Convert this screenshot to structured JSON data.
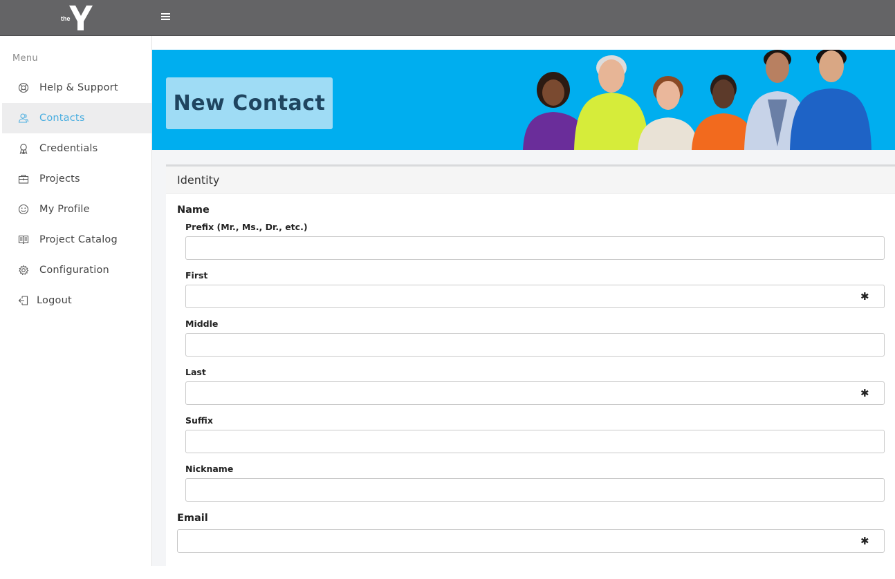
{
  "topbar": {
    "logo_text": "the"
  },
  "sidebar": {
    "menu_title": "Menu",
    "items": [
      {
        "label": "Help & Support",
        "icon": "lifebuoy-icon",
        "active": false
      },
      {
        "label": "Contacts",
        "icon": "users-icon",
        "active": true
      },
      {
        "label": "Credentials",
        "icon": "badge-icon",
        "active": false
      },
      {
        "label": "Projects",
        "icon": "briefcase-icon",
        "active": false
      },
      {
        "label": "My Profile",
        "icon": "smiley-icon",
        "active": false
      },
      {
        "label": "Project Catalog",
        "icon": "book-icon",
        "active": false
      },
      {
        "label": "Configuration",
        "icon": "gear-icon",
        "active": false
      },
      {
        "label": "Logout",
        "icon": "logout-icon",
        "active": false
      }
    ]
  },
  "hero": {
    "title": "New Contact"
  },
  "panel": {
    "title": "Identity",
    "name_section": "Name",
    "fields": {
      "prefix": {
        "label": "Prefix (Mr., Ms., Dr., etc.)",
        "value": ""
      },
      "first": {
        "label": "First",
        "value": "",
        "required_mark": "✱"
      },
      "middle": {
        "label": "Middle",
        "value": ""
      },
      "last": {
        "label": "Last",
        "value": "",
        "required_mark": "✱"
      },
      "suffix": {
        "label": "Suffix",
        "value": ""
      },
      "nickname": {
        "label": "Nickname",
        "value": ""
      }
    },
    "email_section": "Email",
    "email": {
      "value": "",
      "required_mark": "✱"
    }
  },
  "colors": {
    "topbar": "#646466",
    "accent": "#4aaee0",
    "hero_bg": "#00aeef",
    "hero_title_box": "#9fdcf5"
  }
}
